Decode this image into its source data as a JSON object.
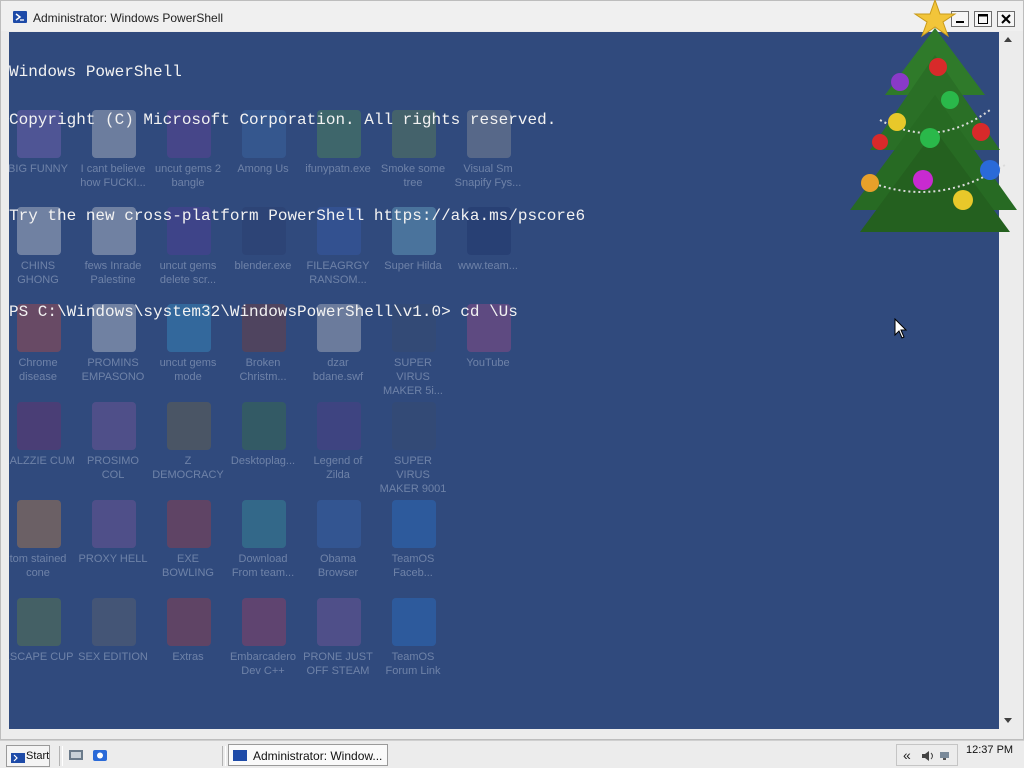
{
  "window": {
    "title": "Administrator: Windows PowerShell",
    "icon": "powershell-icon",
    "controls": [
      "minimize-icon",
      "maximize-icon",
      "close-icon"
    ]
  },
  "console": {
    "lines": [
      "Windows PowerShell",
      "Copyright (C) Microsoft Corporation. All rights reserved.",
      "",
      "Try the new cross-platform PowerShell https://aka.ms/pscore6",
      "",
      "PS C:\\Windows\\system32\\WindowsPowerShell\\v1.0> cd \\Us"
    ],
    "background": "#304a7d",
    "foreground": "#f2f2f2"
  },
  "desktop_icons": [
    {
      "label": "BIG FUNNY",
      "color": "#8a6cc4"
    },
    {
      "label": "I cant believe how FUCKI...",
      "color": "#dddddd"
    },
    {
      "label": "uncut gems 2 bangle",
      "color": "#7040a0"
    },
    {
      "label": "Among Us",
      "color": "#3f6fb0"
    },
    {
      "label": "ifunypatn.exe",
      "color": "#5a9a4a"
    },
    {
      "label": "Smoke some tree",
      "color": "#6b8f4a"
    },
    {
      "label": "Visual Sm Snapify Fys...",
      "color": "#a0a0a0"
    },
    {
      "label": "CHINS GHONG",
      "color": "#e8e8e8"
    },
    {
      "label": "fews Inrade Palestine",
      "color": "#e8e8e8"
    },
    {
      "label": "uncut gems delete scr...",
      "color": "#5a3aa0"
    },
    {
      "label": "blender.exe",
      "color": "#2a3a6a"
    },
    {
      "label": "FILEAGRGY RANSOM...",
      "color": "#3b5fb5"
    },
    {
      "label": "Super Hilda",
      "color": "#7ac0d8"
    },
    {
      "label": "www.team...",
      "color": "#1c2f66"
    },
    {
      "label": "Chrome disease",
      "color": "#d14a3a"
    },
    {
      "label": "PROMINS EMPASONO",
      "color": "#e8e8e8"
    },
    {
      "label": "uncut gems mode",
      "color": "#3aa0d8"
    },
    {
      "label": "Broken Christm...",
      "color": "#8a3a2a"
    },
    {
      "label": "dzar bdane.swf",
      "color": "#d8d8d8"
    },
    {
      "label": "SUPER VIRUS MAKER 5i...",
      "color": "#3a4a6a"
    },
    {
      "label": "YouTube",
      "color": "#b34a8a"
    },
    {
      "label": "GALZZIE CUM",
      "color": "#7a2a6a"
    },
    {
      "label": "PROSIMO COL",
      "color": "#8a5aa0"
    },
    {
      "label": "Z DEMOCRACY",
      "color": "#7a6a3a"
    },
    {
      "label": "Desktoplag...",
      "color": "#3a7a3a"
    },
    {
      "label": "Legend of Zilda",
      "color": "#5a3a8a"
    },
    {
      "label": "SUPER VIRUS MAKER 9001",
      "color": "#3a4a6a"
    },
    {
      "label": "tom stained cone",
      "color": "#d88a3a"
    },
    {
      "label": "PROXY HELL",
      "color": "#8a5aa0"
    },
    {
      "label": "EXE BOWLING",
      "color": "#b83a3a"
    },
    {
      "label": "Download From team...",
      "color": "#3aa0a0"
    },
    {
      "label": "Obama Browser",
      "color": "#3a6ab8"
    },
    {
      "label": "TeamOS Faceb...",
      "color": "#2a7ad8"
    },
    {
      "label": "ESCAPE CUP",
      "color": "#6a8a3a"
    },
    {
      "label": "SEX EDITION",
      "color": "#6a6a6a"
    },
    {
      "label": "Extras",
      "color": "#b83a3a"
    },
    {
      "label": "Embarcadero Dev C++",
      "color": "#b83a5a"
    },
    {
      "label": "PRONE JUST OFF STEAM",
      "color": "#8a5aa0"
    },
    {
      "label": "TeamOS Forum Link",
      "color": "#2a7ad8"
    }
  ],
  "decoration": {
    "name": "christmas-tree"
  },
  "taskbar": {
    "start_label": "Start",
    "quick_launch": [
      "show-desktop-icon",
      "explorer-icon"
    ],
    "task_label": "Administrator: Window...",
    "tray": {
      "chevron": "«",
      "icons": [
        "volume-icon",
        "network-icon"
      ]
    },
    "clock": "12:37 PM"
  }
}
